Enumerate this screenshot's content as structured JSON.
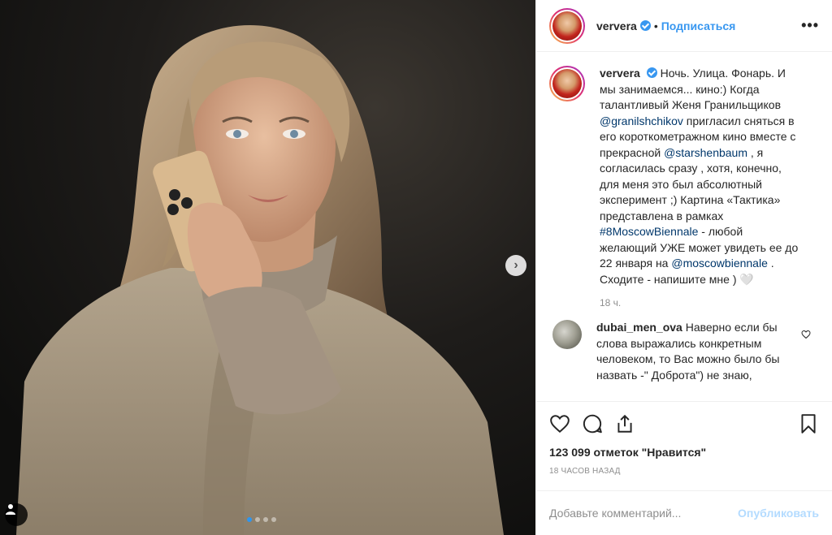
{
  "post": {
    "username": "ververa",
    "follow_label": "Подписаться",
    "separator": "•",
    "more_label": "•••",
    "caption": {
      "username": "ververa",
      "part1": "Ночь. Улица. Фонарь. И мы занимаемся... кино:) Когда талантливый Женя Гранильщиков ",
      "mention1": "@granilshchikov",
      "part2": " пригласил сняться в его короткометражном кино вместе с прекрасной ",
      "mention2": "@starshenbaum",
      "part3": " , я согласилась сразу , хотя, конечно, для меня это был абсолютный эксперимент ;) Картина «Тактика» представлена в рамках ",
      "hashtag": "#8MoscowBiennale",
      "part4": " - любой желающий УЖЕ может увидеть ее до 22 января на ",
      "mention3": "@moscowbiennale",
      "part5": " . Сходите - напишите мне ) 🤍",
      "time": "18 ч."
    },
    "comments": [
      {
        "username": "dubai_men_ova",
        "text": "Наверно если бы слова выражались конкретным человеком, то Вас можно было бы назвать -\" Доброта\") не знаю,"
      }
    ],
    "likes": "123 099 отметок \"Нравится\"",
    "posted_ago": "18 ЧАСОВ НАЗАД",
    "comment_placeholder": "Добавьте комментарий...",
    "publish_label": "Опубликовать",
    "carousel": {
      "total": 4,
      "active_index": 0
    },
    "next_arrow": "›"
  },
  "icons": {
    "verified": "verified-badge-icon",
    "like": "heart-icon",
    "comment": "comment-bubble-icon",
    "share": "share-icon",
    "save": "bookmark-icon",
    "tag": "user-tag-icon",
    "next": "chevron-right-icon"
  },
  "colors": {
    "accent": "#3897f0",
    "link": "#00376b",
    "muted": "#8e8e8e",
    "publish_disabled": "#b3dbff"
  }
}
